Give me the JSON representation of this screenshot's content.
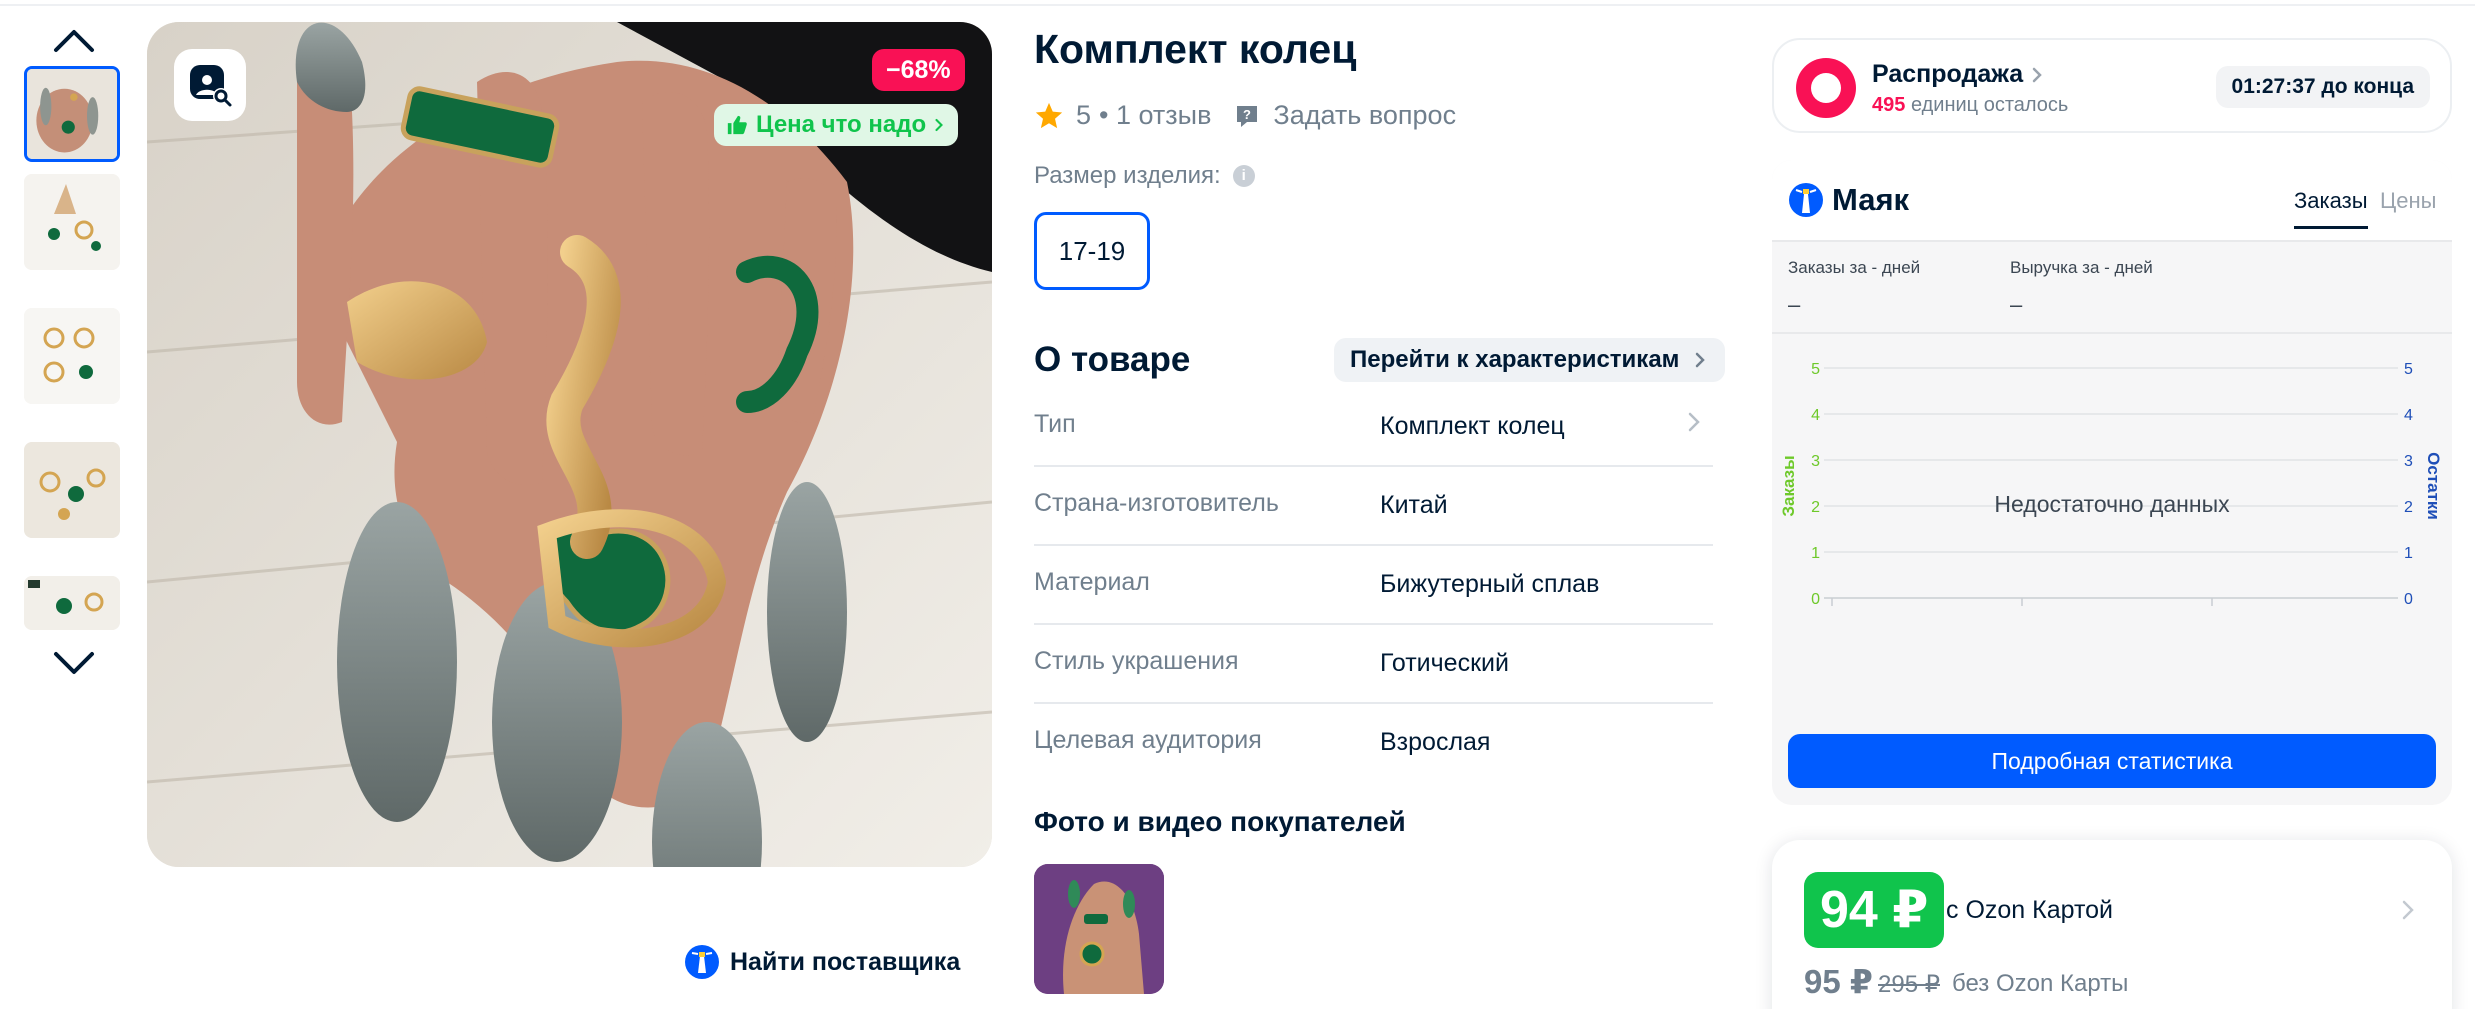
{
  "product": {
    "title": "Комплект колец",
    "rating": "5",
    "reviews": "• 1 отзыв",
    "ask_question": "Задать вопрос",
    "size_label": "Размер изделия:",
    "size_info_icon": "i",
    "size_selected": "17-19"
  },
  "image": {
    "discount_badge": "−68%",
    "price_badge": "Цена что надо",
    "find_supplier": "Найти поставщика"
  },
  "about": {
    "title": "О товаре",
    "specs_link": "Перейти к характеристикам",
    "specs": [
      {
        "key": "Тип",
        "value": "Комплект колец"
      },
      {
        "key": "Страна-изготовитель",
        "value": "Китай"
      },
      {
        "key": "Материал",
        "value": "Бижутерный сплав"
      },
      {
        "key": "Стиль украшения",
        "value": "Готический"
      },
      {
        "key": "Целевая аудитория",
        "value": "Взрослая"
      }
    ]
  },
  "buyer_photos": {
    "title": "Фото и видео покупателей"
  },
  "sale": {
    "title": "Распродажа",
    "units_left": "495",
    "units_text": "единиц осталось",
    "timer": "01:27:37 до конца"
  },
  "mayak": {
    "logo": "Маяк",
    "tab_orders": "Заказы",
    "tab_prices": "Цены",
    "orders_label": "Заказы за - дней",
    "orders_value": "–",
    "revenue_label": "Выручка за - дней",
    "revenue_value": "–",
    "detail_button": "Подробная статистика"
  },
  "chart_data": {
    "type": "line",
    "title": "",
    "empty_message": "Недостаточно данных",
    "y_left_label": "Заказы",
    "y_right_label": "Остатки",
    "y_ticks": [
      0,
      1,
      2,
      3,
      4,
      5
    ],
    "ylim": [
      0,
      5
    ],
    "series": [],
    "grid": true,
    "colors": {
      "left_axis": "#6ec92a",
      "right_axis": "#1f4fb8"
    }
  },
  "price": {
    "ozon_price": "94 ₽",
    "ozon_note": "с Ozon Картой",
    "regular_price": "95 ₽",
    "old_price": "295 ₽",
    "no_card_note": "без Ozon Карты"
  },
  "colors": {
    "accent": "#005bff",
    "sale": "#f91155",
    "green": "#10c44c",
    "text": "#001a34",
    "muted": "#707f8d"
  },
  "icons": {
    "thumb_up": "up-chevron-icon",
    "thumb_down": "down-chevron-icon",
    "image_search": "image-search-icon",
    "star": "star-icon",
    "question": "question-icon",
    "lighthouse": "lighthouse-icon"
  }
}
